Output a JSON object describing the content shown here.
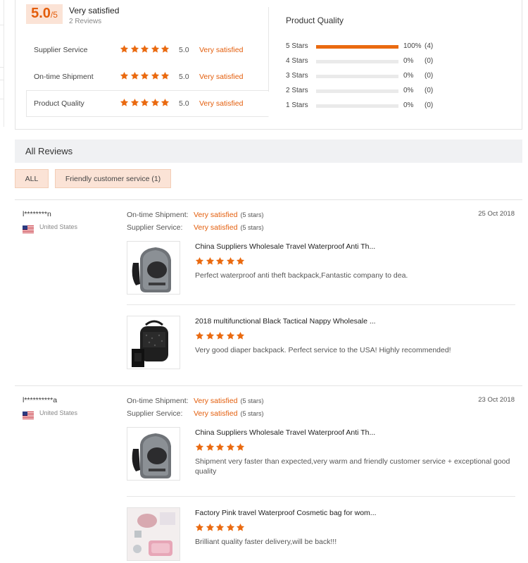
{
  "colors": {
    "accent": "#e35d0b",
    "star": "#ea6a10",
    "badge_bg": "#fbe3d6"
  },
  "summary": {
    "score_big": "5.0",
    "score_small": "/5",
    "overall_label": "Very satisfied",
    "review_count": "2 Reviews",
    "dsr": [
      {
        "label": "Supplier Service",
        "stars": 5,
        "score": "5.0",
        "desc": "Very satisfied"
      },
      {
        "label": "On-time Shipment",
        "stars": 5,
        "score": "5.0",
        "desc": "Very satisfied"
      },
      {
        "label": "Product Quality",
        "stars": 5,
        "score": "5.0",
        "desc": "Very satisfied"
      }
    ],
    "distribution_title": "Product Quality",
    "distribution": [
      {
        "label": "5  Stars",
        "fill": 1.0,
        "pct": "100%",
        "count": "(4)"
      },
      {
        "label": "4  Stars",
        "fill": 0,
        "pct": "0%",
        "count": "(0)"
      },
      {
        "label": "3  Stars",
        "fill": 0,
        "pct": "0%",
        "count": "(0)"
      },
      {
        "label": "2  Stars",
        "fill": 0,
        "pct": "0%",
        "count": "(0)"
      },
      {
        "label": "1  Stars",
        "fill": 0,
        "pct": "0%",
        "count": "(0)"
      }
    ]
  },
  "all_reviews_title": "All Reviews",
  "filters": {
    "all": "ALL",
    "friendly": "Friendly customer service (1)"
  },
  "reviews": [
    {
      "user": "l********n",
      "country": "United States",
      "date": "25 Oct 2018",
      "shipment_label": "On-time Shipment:",
      "shipment_val": "Very satisfied",
      "shipment_stars": "(5 stars)",
      "supplier_label": "Supplier Service:",
      "supplier_val": "Very satisfied",
      "supplier_stars": "(5 stars)",
      "items": [
        {
          "title": "China Suppliers Wholesale Travel Waterproof Anti Th...",
          "text": "Perfect waterproof anti theft backpack,Fantastic company to dea.",
          "thumb": "gray-backpack"
        },
        {
          "title": "2018 multifunctional Black Tactical Nappy Wholesale ...",
          "text": "Very good diaper backpack. Perfect service to the USA! Highly recommended!",
          "thumb": "black-diaper-bag"
        }
      ]
    },
    {
      "user": "l**********a",
      "country": "United States",
      "date": "23 Oct 2018",
      "shipment_label": "On-time Shipment:",
      "shipment_val": "Very satisfied",
      "shipment_stars": "(5 stars)",
      "supplier_label": "Supplier Service:",
      "supplier_val": "Very satisfied",
      "supplier_stars": "(5 stars)",
      "items": [
        {
          "title": "China Suppliers Wholesale Travel Waterproof Anti Th...",
          "text": "Shipment very faster than expected,very warm and friendly customer service + exceptional good quality",
          "thumb": "gray-backpack"
        },
        {
          "title": "Factory Pink travel Waterproof Cosmetic bag for wom...",
          "text": "Brilliant quality faster delivery,will be back!!!",
          "thumb": "pink-cosmetic-bag"
        }
      ]
    }
  ]
}
